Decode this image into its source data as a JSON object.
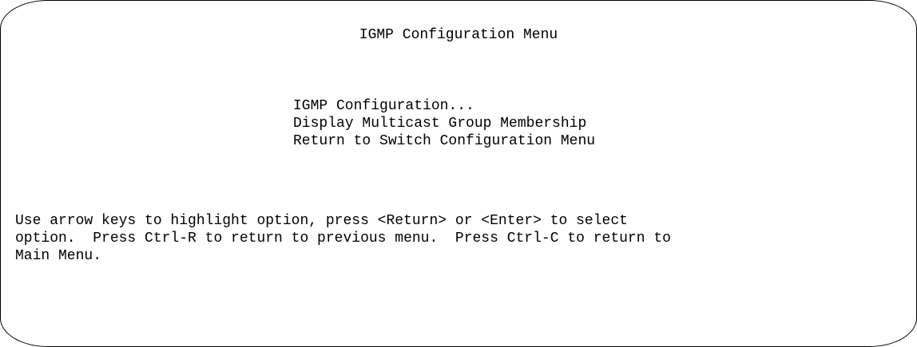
{
  "menu": {
    "title": "IGMP Configuration Menu",
    "items": [
      {
        "label": "IGMP Configuration..."
      },
      {
        "label": "Display Multicast Group Membership"
      },
      {
        "label": "Return to Switch Configuration Menu"
      }
    ]
  },
  "help": {
    "lines": [
      "Use arrow keys to highlight option, press <Return> or <Enter> to select",
      "option.  Press Ctrl-R to return to previous menu.  Press Ctrl-C to return to",
      "Main Menu."
    ]
  }
}
